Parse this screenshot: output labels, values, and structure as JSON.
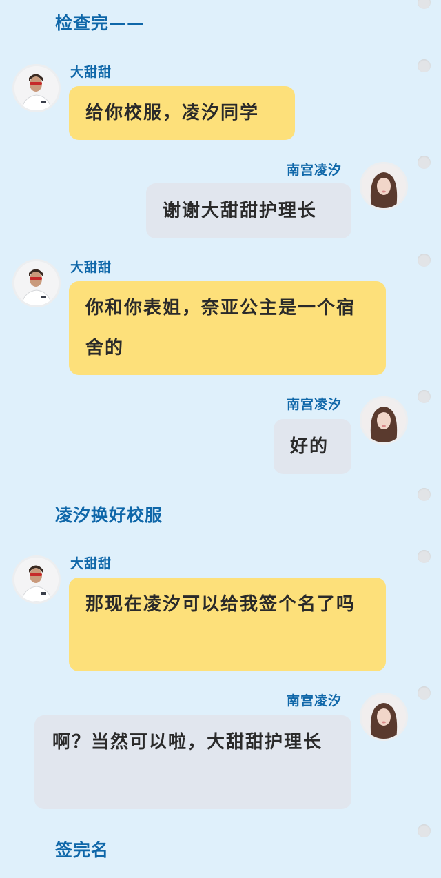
{
  "colors": {
    "background": "#dff0fb",
    "accent_text": "#0f67a9",
    "bubble_yellow": "#fde07a",
    "bubble_gray": "#e1e6ee"
  },
  "speakers": {
    "nurse": "大甜甜",
    "girl": "南宫凌汐"
  },
  "narrations": [
    "检查完——",
    "凌汐换好校服",
    "签完名"
  ],
  "messages": [
    {
      "speaker": "大甜甜",
      "side": "left",
      "text": "给你校服，凌汐同学"
    },
    {
      "speaker": "南宫凌汐",
      "side": "right",
      "text": "谢谢大甜甜护理长"
    },
    {
      "speaker": "大甜甜",
      "side": "left",
      "text": "你和你表姐，奈亚公主是一个宿舍的"
    },
    {
      "speaker": "南宫凌汐",
      "side": "right",
      "text": "好的"
    },
    {
      "speaker": "大甜甜",
      "side": "left",
      "text": "那现在凌汐可以给我签个名了吗"
    },
    {
      "speaker": "南宫凌汐",
      "side": "right",
      "text": "啊？当然可以啦，大甜甜护理长"
    }
  ],
  "icons": {
    "nurse_avatar": "nurse-avatar-icon",
    "girl_avatar": "girl-avatar-icon",
    "binder_hole": "binder-hole-icon"
  }
}
